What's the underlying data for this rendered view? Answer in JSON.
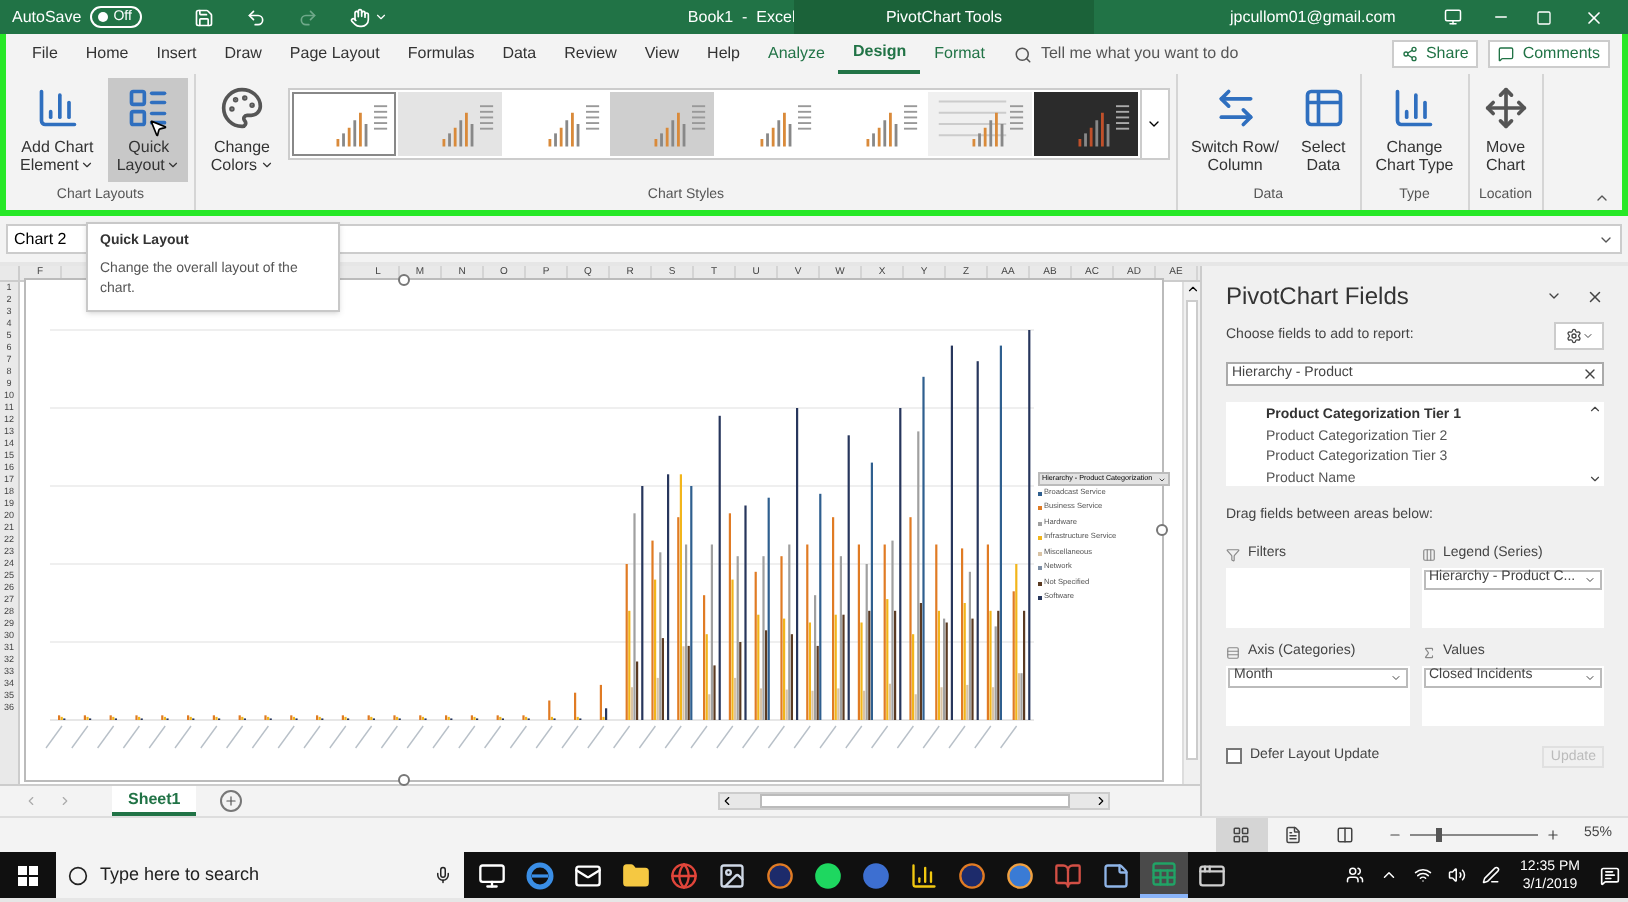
{
  "title_bar": {
    "autosave_label": "AutoSave",
    "autosave_state": "Off",
    "autosave_on": false,
    "document_title": "Book1  -  Excel",
    "context_title": "PivotChart Tools",
    "account": "jpcullom01@gmail.com"
  },
  "tabs": [
    {
      "label": "File",
      "kind": "normal",
      "selected": false
    },
    {
      "label": "Home",
      "kind": "normal",
      "selected": false
    },
    {
      "label": "Insert",
      "kind": "normal",
      "selected": false
    },
    {
      "label": "Draw",
      "kind": "normal",
      "selected": false
    },
    {
      "label": "Page Layout",
      "kind": "normal",
      "selected": false
    },
    {
      "label": "Formulas",
      "kind": "normal",
      "selected": false
    },
    {
      "label": "Data",
      "kind": "normal",
      "selected": false
    },
    {
      "label": "Review",
      "kind": "normal",
      "selected": false
    },
    {
      "label": "View",
      "kind": "normal",
      "selected": false
    },
    {
      "label": "Help",
      "kind": "normal",
      "selected": false
    },
    {
      "label": "Analyze",
      "kind": "contextual",
      "selected": false
    },
    {
      "label": "Design",
      "kind": "contextual",
      "selected": true
    },
    {
      "label": "Format",
      "kind": "contextual",
      "selected": false
    }
  ],
  "tell_me": {
    "placeholder": "Tell me what you want to do"
  },
  "share_button": "Share",
  "comments_button": "Comments",
  "ribbon_groups": [
    {
      "label": "Chart Layouts",
      "buttons": [
        {
          "kind": "add-element",
          "lines": [
            "Add Chart",
            "Element"
          ],
          "dropdown": true,
          "hovered": false
        },
        {
          "kind": "quick-layout",
          "lines": [
            "Quick",
            "Layout"
          ],
          "dropdown": true,
          "hovered": true
        }
      ]
    },
    {
      "label": "Chart Styles",
      "buttons": [
        {
          "kind": "colors",
          "lines": [
            "Change",
            "Colors"
          ],
          "dropdown": true,
          "hovered": false
        }
      ],
      "styles": [
        {
          "kind": "white",
          "selected": true
        },
        {
          "kind": "shaded",
          "selected": false
        },
        {
          "kind": "white",
          "selected": false
        },
        {
          "kind": "gray",
          "selected": false
        },
        {
          "kind": "white",
          "selected": false
        },
        {
          "kind": "white",
          "selected": false
        },
        {
          "kind": "striped",
          "selected": false
        },
        {
          "kind": "dark",
          "selected": false
        }
      ]
    },
    {
      "label": "Data",
      "buttons": [
        {
          "kind": "switch",
          "lines": [
            "Switch Row/",
            "Column"
          ],
          "dropdown": false,
          "hovered": false
        },
        {
          "kind": "select-data",
          "lines": [
            "Select",
            "Data"
          ],
          "dropdown": false,
          "hovered": false
        }
      ]
    },
    {
      "label": "Type",
      "buttons": [
        {
          "kind": "chart-type",
          "lines": [
            "Change",
            "Chart Type"
          ],
          "dropdown": false,
          "hovered": false
        }
      ]
    },
    {
      "label": "Location",
      "buttons": [
        {
          "kind": "move",
          "lines": [
            "Move",
            "Chart"
          ],
          "dropdown": false,
          "hovered": false
        }
      ]
    }
  ],
  "tooltip": {
    "title": "Quick Layout",
    "text": "Change the overall layout of the chart."
  },
  "name_box": {
    "value": "Chart 2"
  },
  "columns": [
    "F",
    "L",
    "M",
    "N",
    "O",
    "P",
    "Q",
    "R",
    "S",
    "T",
    "U",
    "V",
    "W",
    "X",
    "Y",
    "Z",
    "AA",
    "AB",
    "AC",
    "AD",
    "AE"
  ],
  "rows": [
    "1",
    "2",
    "3",
    "4",
    "5",
    "6",
    "7",
    "8",
    "9",
    "10",
    "11",
    "12",
    "13",
    "14",
    "15",
    "16",
    "17",
    "18",
    "19",
    "20",
    "21",
    "22",
    "23",
    "24",
    "25",
    "26",
    "27",
    "28",
    "29",
    "30",
    "31",
    "32",
    "33",
    "34",
    "35",
    "36"
  ],
  "chart": {
    "legend_title": "Hierarchy - Product Categorization",
    "legend": [
      {
        "label": "Broadcast Service",
        "color": "#2f5f8f"
      },
      {
        "label": "Business Service",
        "color": "#e07b24"
      },
      {
        "label": "Hardware",
        "color": "#a0a0a0"
      },
      {
        "label": "Infrastructure Service",
        "color": "#f2b51b"
      },
      {
        "label": "Miscellaneous",
        "color": "#d9c3a5"
      },
      {
        "label": "Network",
        "color": "#7d8ea5"
      },
      {
        "label": "Not Specified",
        "color": "#5a3a22"
      },
      {
        "label": "Software",
        "color": "#27365c"
      }
    ]
  },
  "sheet_tabs": [
    {
      "label": "Sheet1",
      "selected": true
    }
  ],
  "field_pane": {
    "title": "PivotChart Fields",
    "subtitle": "Choose fields to add to report:",
    "search_value": "Hierarchy - Product",
    "fields": [
      {
        "label": "Product Categorization Tier 1",
        "active": true
      },
      {
        "label": "Product Categorization Tier 2",
        "active": false
      },
      {
        "label": "Product Categorization Tier 3",
        "active": false
      },
      {
        "label": "Product Name",
        "active": false
      }
    ],
    "drag_hint": "Drag fields between areas below:",
    "areas": [
      {
        "kind": "filters",
        "label": "Filters"
      },
      {
        "kind": "legend",
        "label": "Legend (Series)",
        "items": [
          "Hierarchy - Product C..."
        ]
      },
      {
        "kind": "axis",
        "label": "Axis (Categories)",
        "items": [
          "Month"
        ]
      },
      {
        "kind": "values",
        "label": "Values",
        "items": [
          "Closed Incidents"
        ]
      }
    ],
    "defer_update": {
      "label": "Defer Layout Update",
      "checked": false
    },
    "update_button": {
      "label": "Update",
      "disabled": true
    }
  },
  "status_bar": {
    "views": [
      {
        "kind": "normal",
        "selected": true
      },
      {
        "kind": "page-layout",
        "selected": false
      },
      {
        "kind": "page-break",
        "selected": false
      }
    ],
    "zoom": {
      "level": 0.2,
      "reading": "55%"
    }
  },
  "taskbar": {
    "search_placeholder": "Type here to search",
    "apps": [
      {
        "kind": "task-view",
        "active": false
      },
      {
        "kind": "browser-e",
        "active": false
      },
      {
        "kind": "mail",
        "active": false
      },
      {
        "kind": "folder",
        "active": false
      },
      {
        "kind": "globe",
        "active": false
      },
      {
        "kind": "photo",
        "active": false
      },
      {
        "kind": "orange-ball",
        "active": false
      },
      {
        "kind": "green-circle",
        "active": false
      },
      {
        "kind": "blue-circle",
        "active": false
      },
      {
        "kind": "chart",
        "active": false
      },
      {
        "kind": "orange-ball",
        "active": false
      },
      {
        "kind": "blue-ball",
        "active": false
      },
      {
        "kind": "book",
        "active": false
      },
      {
        "kind": "note",
        "active": false
      },
      {
        "kind": "spreadsheet",
        "active": true
      },
      {
        "kind": "window",
        "active": false
      }
    ],
    "time": "12:35 PM",
    "date": "3/1/2019"
  }
}
